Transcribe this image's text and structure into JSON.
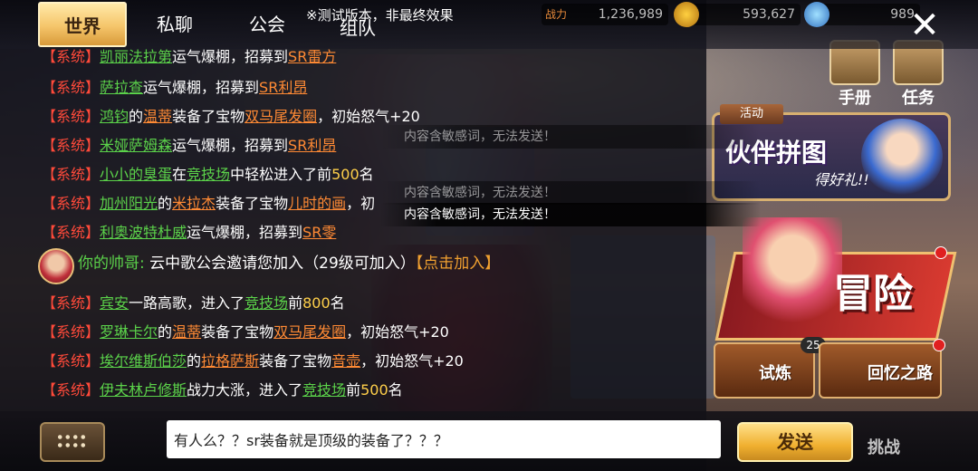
{
  "tabs": [
    {
      "label": "世界",
      "active": true
    },
    {
      "label": "私聊",
      "active": false
    },
    {
      "label": "公会",
      "active": false
    },
    {
      "label": "组队",
      "active": false
    }
  ],
  "notice": "※测试版本，非最终效果",
  "hud": {
    "power_label": "战力",
    "power": "1,236,989",
    "gold": "593,627",
    "gems": "989"
  },
  "close_label": "✕",
  "messages": [
    {
      "tag": "【系统】",
      "parts": [
        {
          "t": "凯丽法拉第",
          "c": "name"
        },
        {
          "t": "运气爆棚，招募到",
          "c": ""
        },
        {
          "t": "SR雷方",
          "c": "item"
        }
      ]
    },
    {
      "tag": "【系统】",
      "parts": [
        {
          "t": "萨拉查",
          "c": "name"
        },
        {
          "t": "运气爆棚，招募到",
          "c": ""
        },
        {
          "t": "SR利昂",
          "c": "item"
        }
      ]
    },
    {
      "tag": "【系统】",
      "parts": [
        {
          "t": "鸿钧",
          "c": "name"
        },
        {
          "t": "的",
          "c": ""
        },
        {
          "t": "温蒂",
          "c": "item"
        },
        {
          "t": "装备了宝物",
          "c": ""
        },
        {
          "t": "双马尾发圈",
          "c": "item"
        },
        {
          "t": "，初始怒气+20",
          "c": ""
        }
      ]
    },
    {
      "tag": "【系统】",
      "parts": [
        {
          "t": "米娅萨姆森",
          "c": "name"
        },
        {
          "t": "运气爆棚，招募到",
          "c": ""
        },
        {
          "t": "SR利昂",
          "c": "item"
        }
      ]
    },
    {
      "tag": "【系统】",
      "parts": [
        {
          "t": "小小的臭蛋",
          "c": "name"
        },
        {
          "t": "在",
          "c": ""
        },
        {
          "t": "竞技场",
          "c": "name"
        },
        {
          "t": "中轻松进入了前",
          "c": ""
        },
        {
          "t": "500",
          "c": "num"
        },
        {
          "t": "名",
          "c": ""
        }
      ]
    },
    {
      "tag": "【系统】",
      "parts": [
        {
          "t": "加州阳光",
          "c": "name"
        },
        {
          "t": "的",
          "c": ""
        },
        {
          "t": "米拉杰",
          "c": "item"
        },
        {
          "t": "装备了宝物",
          "c": ""
        },
        {
          "t": "儿时的画",
          "c": "item"
        },
        {
          "t": "，初",
          "c": ""
        }
      ]
    },
    {
      "tag": "【系统】",
      "parts": [
        {
          "t": "利奥波特杜威",
          "c": "name"
        },
        {
          "t": "运气爆棚，招募到",
          "c": ""
        },
        {
          "t": "SR零",
          "c": "item"
        }
      ]
    },
    {
      "tag": "【系统】",
      "parts": [
        {
          "t": "宾安",
          "c": "name"
        },
        {
          "t": "一路高歌，进入了",
          "c": ""
        },
        {
          "t": "竞技场",
          "c": "name"
        },
        {
          "t": "前",
          "c": ""
        },
        {
          "t": "800",
          "c": "num"
        },
        {
          "t": "名",
          "c": ""
        }
      ]
    },
    {
      "tag": "【系统】",
      "parts": [
        {
          "t": "罗琳卡尔",
          "c": "name"
        },
        {
          "t": "的",
          "c": ""
        },
        {
          "t": "温蒂",
          "c": "item"
        },
        {
          "t": "装备了宝物",
          "c": ""
        },
        {
          "t": "双马尾发圈",
          "c": "item"
        },
        {
          "t": "，初始怒气+20",
          "c": ""
        }
      ]
    },
    {
      "tag": "【系统】",
      "parts": [
        {
          "t": "埃尔维斯伯莎",
          "c": "name"
        },
        {
          "t": "的",
          "c": ""
        },
        {
          "t": "拉格萨斯",
          "c": "item"
        },
        {
          "t": "装备了宝物",
          "c": ""
        },
        {
          "t": "音壶",
          "c": "item"
        },
        {
          "t": "，初始怒气+20",
          "c": ""
        }
      ]
    },
    {
      "tag": "【系统】",
      "parts": [
        {
          "t": "伊夫林卢修斯",
          "c": "name"
        },
        {
          "t": "战力大涨，进入了",
          "c": ""
        },
        {
          "t": "竞技场",
          "c": "name"
        },
        {
          "t": "前",
          "c": ""
        },
        {
          "t": "500",
          "c": "num"
        },
        {
          "t": "名",
          "c": ""
        }
      ]
    }
  ],
  "player_msg": {
    "sender": "你的帅哥:",
    "text": " 云中歌公会邀请您加入（29级可加入）",
    "action": "【点击加入】"
  },
  "toasts": [
    "内容含敏感词，无法发送！",
    "内容含敏感词，无法发送！",
    "内容含敏感词，无法发送！"
  ],
  "side": {
    "handbook": "手册",
    "quest": "任务",
    "event_tag": "活动",
    "event_title": "伙伴拼图",
    "event_sub": "得好礼!!",
    "adventure": "冒险",
    "trial": "试炼",
    "trial_badge": "25",
    "memory": "回忆之路",
    "challenge": "挑战"
  },
  "input": {
    "value": "有人么？？sr装备就是顶级的装备了？？？"
  },
  "send_label": "发送"
}
